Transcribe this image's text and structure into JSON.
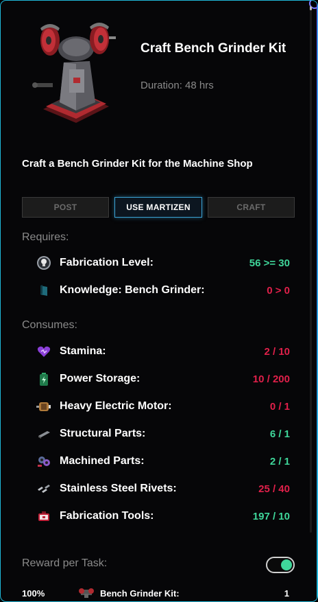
{
  "header": {
    "title": "Craft Bench Grinder Kit",
    "duration": "Duration: 48 hrs"
  },
  "description": "Craft a Bench Grinder Kit for the Machine Shop",
  "actions": {
    "post_label": "POST",
    "martizen_label": "USE MARTIZEN",
    "craft_label": "CRAFT"
  },
  "requires": {
    "label": "Requires:",
    "items": [
      {
        "label": "Fabrication Level:",
        "value": "56 >= 30",
        "status": "met",
        "icon": "lightbulb-icon"
      },
      {
        "label": "Knowledge: Bench Grinder:",
        "value": "0 > 0",
        "status": "unmet",
        "icon": "knowledge-book-icon"
      }
    ]
  },
  "consumes": {
    "label": "Consumes:",
    "items": [
      {
        "label": "Stamina:",
        "value": "2 / 10",
        "status": "unmet",
        "icon": "stamina-heart-icon"
      },
      {
        "label": "Power Storage:",
        "value": "10 / 200",
        "status": "unmet",
        "icon": "battery-icon"
      },
      {
        "label": "Heavy Electric Motor:",
        "value": "0 / 1",
        "status": "unmet",
        "icon": "electric-motor-icon"
      },
      {
        "label": "Structural Parts:",
        "value": "6 / 1",
        "status": "met",
        "icon": "structural-parts-icon"
      },
      {
        "label": "Machined Parts:",
        "value": "2 / 1",
        "status": "met",
        "icon": "machined-parts-icon"
      },
      {
        "label": "Stainless Steel Rivets:",
        "value": "25 / 40",
        "status": "unmet",
        "icon": "rivets-icon"
      },
      {
        "label": "Fabrication Tools:",
        "value": "197 / 10",
        "status": "met",
        "icon": "toolbox-icon"
      }
    ]
  },
  "reward": {
    "label": "Reward per Task:",
    "toggle_on": true,
    "items": [
      {
        "percent": "100%",
        "label": "Bench Grinder Kit:",
        "value": "1",
        "icon": "bench-grinder-icon"
      }
    ]
  },
  "colors": {
    "met": "#3fd69a",
    "unmet": "#e0204a",
    "accent": "#3ba3d6"
  }
}
